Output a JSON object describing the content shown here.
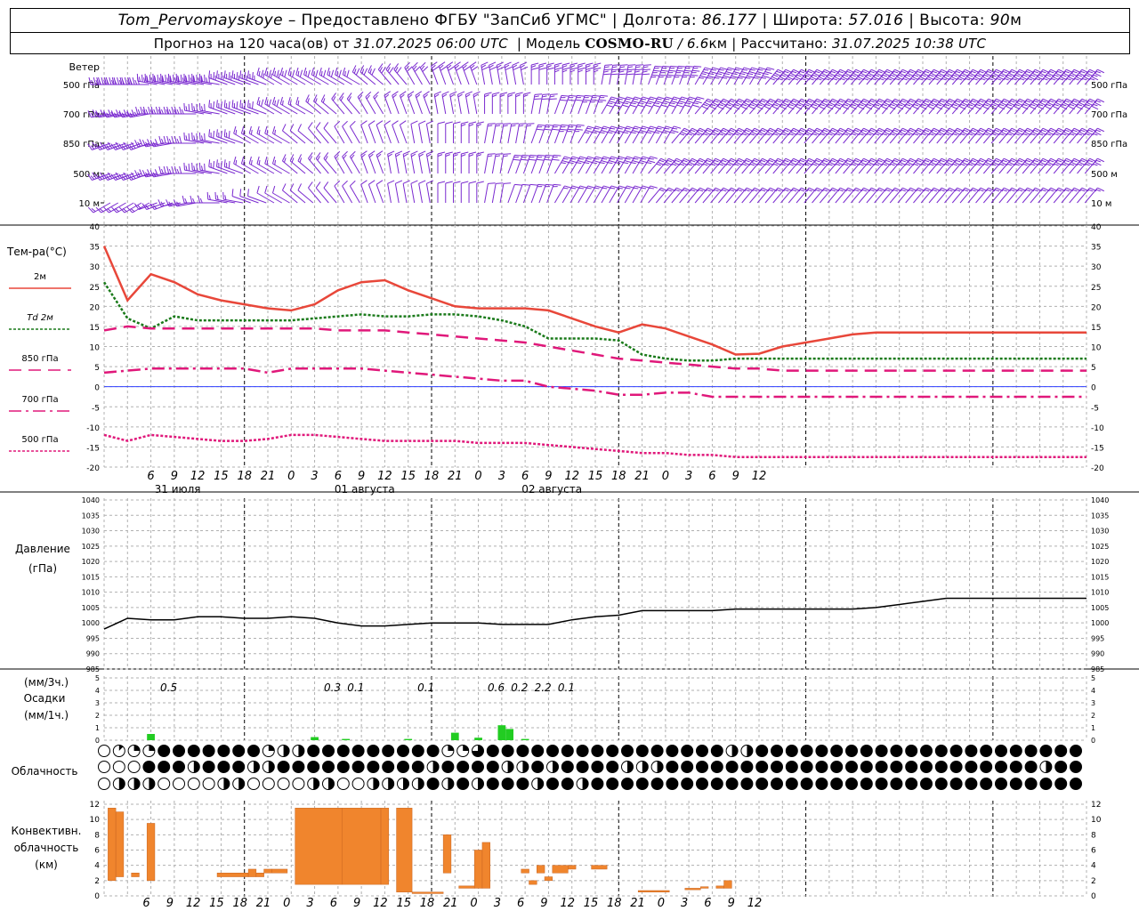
{
  "header": {
    "station": "Tom_Pervomayskoye",
    "dash": "–",
    "provider": "Предоставлено ФГБУ \"ЗапСиб УГМС\"",
    "lon_label": "Долгота:",
    "lon": "86.177",
    "lat_label": "Широта:",
    "lat": "57.016",
    "alt_label": "Высота:",
    "alt": "90",
    "alt_unit": "м",
    "sep": "|",
    "forecast_label": "Прогноз на 120 часа(ов)  от",
    "init": "31.07.2025 06:00 UTC",
    "model_label": "Модель",
    "model": "COSMO-RU",
    "model_res": "/ 6.6",
    "res_unit": "км",
    "calc_label": "Рассчитано:",
    "calc": "31.07.2025 10:38 UTC"
  },
  "labels": {
    "wind": "Ветер",
    "wind_levels": [
      "500 гПа",
      "700 гПа",
      "850 гПа",
      "500  м",
      "10   м"
    ],
    "temp": "Тем-ра(°С)",
    "pressure": [
      "Давление",
      "(гПа)"
    ],
    "precip": [
      "(мм/3ч.)",
      "Осадки",
      "(мм/1ч.)"
    ],
    "cloud": "Облачность",
    "conv": [
      "Конвективн.",
      "облачность",
      "(км)"
    ]
  },
  "colors": {
    "t2m": "#e8473a",
    "td": "#1a7a1a",
    "t850": "#e0187a",
    "t700": "#e0187a",
    "t500": "#e0187a",
    "wind": "#7a2ad0",
    "precip": "#22cc22",
    "conv": "#f0852d",
    "grid": "#b0b0b0"
  },
  "chart_data": [
    {
      "type": "line",
      "panel": "temperature",
      "ylabel": "Тем-ра(°С)",
      "ylim": [
        -20,
        40
      ],
      "yticks": [
        -20,
        -15,
        -10,
        -5,
        0,
        5,
        10,
        15,
        20,
        25,
        30,
        35,
        40
      ],
      "x_hours": [
        0,
        3,
        6,
        9,
        12,
        15,
        18,
        21,
        24,
        27,
        30,
        33,
        36,
        39,
        42,
        45,
        48,
        51,
        54,
        57,
        60,
        63,
        66,
        69,
        72,
        75,
        78,
        81,
        84,
        87,
        90,
        93,
        96,
        99,
        102,
        105,
        108,
        111,
        114,
        117,
        120,
        123,
        126
      ],
      "xtick_labels": [
        "6",
        "9",
        "12",
        "15",
        "18",
        "21",
        "0",
        "3",
        "6",
        "9",
        "12",
        "15",
        "18",
        "21",
        "0",
        "3",
        "6",
        "9",
        "12",
        "15",
        "18",
        "21",
        "0",
        "3",
        "6",
        "9",
        "12"
      ],
      "date_labels": [
        {
          "label": "31 июля",
          "hour": 6
        },
        {
          "label": "01 августа",
          "hour": 30
        },
        {
          "label": "02 августа",
          "hour": 54
        }
      ],
      "series": [
        {
          "name": "2м",
          "key": "t2m",
          "values": [
            35,
            21.5,
            28,
            26,
            23,
            21.5,
            20.5,
            19.5,
            19,
            20.5,
            24,
            26,
            26.5,
            24,
            22,
            20,
            19.5,
            19.5,
            19.5,
            19,
            17,
            15,
            13.5,
            15.5,
            14.5,
            12.5,
            10.5,
            8,
            8.2,
            10,
            11,
            12,
            13,
            13.5,
            13.5,
            13.5,
            13.5,
            13.5,
            13.5,
            13.5,
            13.5,
            13.5,
            13.5
          ]
        },
        {
          "name": "Td 2м",
          "key": "td",
          "values": [
            26,
            17,
            14.5,
            17.5,
            16.5,
            16.5,
            16.5,
            16.5,
            16.5,
            17,
            17.5,
            18,
            17.5,
            17.5,
            18,
            18,
            17.5,
            16.5,
            15,
            12,
            12,
            12,
            11.5,
            8,
            7,
            6.5,
            6.5,
            7,
            7,
            7,
            7,
            7,
            7,
            7,
            7,
            7,
            7,
            7,
            7,
            7,
            7,
            7,
            7
          ]
        },
        {
          "name": "850 гПа",
          "key": "t850",
          "values": [
            14,
            15,
            14.5,
            14.5,
            14.5,
            14.5,
            14.5,
            14.5,
            14.5,
            14.5,
            14,
            14,
            14,
            13.5,
            13,
            12.5,
            12,
            11.5,
            11,
            10,
            9,
            8,
            7,
            6.5,
            6,
            5.5,
            5,
            4.5,
            4.5,
            4,
            4,
            4,
            4,
            4,
            4,
            4,
            4,
            4,
            4,
            4,
            4,
            4,
            4
          ]
        },
        {
          "name": "700 гПа",
          "key": "t700",
          "values": [
            3.5,
            4,
            4.5,
            4.5,
            4.5,
            4.5,
            4.5,
            3.5,
            4.5,
            4.5,
            4.5,
            4.5,
            4,
            3.5,
            3,
            2.5,
            2,
            1.5,
            1.5,
            0,
            -0.5,
            -1,
            -2,
            -2,
            -1.5,
            -1.5,
            -2.5,
            -2.5,
            -2.5,
            -2.5,
            -2.5,
            -2.5,
            -2.5,
            -2.5,
            -2.5,
            -2.5,
            -2.5,
            -2.5,
            -2.5,
            -2.5,
            -2.5,
            -2.5,
            -2.5
          ]
        },
        {
          "name": "500 гПа",
          "key": "t500",
          "values": [
            -12,
            -13.5,
            -12,
            -12.5,
            -13,
            -13.5,
            -13.5,
            -13,
            -12,
            -12,
            -12.5,
            -13,
            -13.5,
            -13.5,
            -13.5,
            -13.5,
            -14,
            -14,
            -14,
            -14.5,
            -15,
            -15.5,
            -16,
            -16.5,
            -16.5,
            -17,
            -17,
            -17.5,
            -17.5,
            -17.5,
            -17.5,
            -17.5,
            -17.5,
            -17.5,
            -17.5,
            -17.5,
            -17.5,
            -17.5,
            -17.5,
            -17.5,
            -17.5,
            -17.5,
            -17.5
          ]
        }
      ]
    },
    {
      "type": "line",
      "panel": "pressure",
      "ylabel": "Давление (гПа)",
      "ylim": [
        985,
        1040
      ],
      "yticks": [
        985,
        990,
        995,
        1000,
        1005,
        1010,
        1015,
        1020,
        1025,
        1030,
        1035,
        1040
      ],
      "series": [
        {
          "name": "pressure",
          "values": [
            998,
            1001.5,
            1001,
            1001,
            1002,
            1002,
            1001.5,
            1001.5,
            1002,
            1001.5,
            1000,
            999,
            999,
            999.5,
            1000,
            1000,
            1000,
            999.5,
            999.5,
            999.5,
            1001,
            1002,
            1002.5,
            1004,
            1004,
            1004,
            1004,
            1004.5,
            1004.5,
            1004.5,
            1004.5,
            1004.5,
            1004.5,
            1005,
            1006,
            1007,
            1008,
            1008,
            1008,
            1008,
            1008,
            1008,
            1008
          ]
        }
      ]
    },
    {
      "type": "bar",
      "panel": "precipitation",
      "ylabel": "Осадки",
      "ylim": [
        0,
        5
      ],
      "yticks": [
        0,
        1,
        2,
        3,
        4,
        5
      ],
      "bars": [
        {
          "hour": 5.5,
          "value": 0.5
        },
        {
          "hour": 26.5,
          "value": 0.25
        },
        {
          "hour": 30.5,
          "value": 0.1
        },
        {
          "hour": 38.5,
          "value": 0.1
        },
        {
          "hour": 44.5,
          "value": 0.6
        },
        {
          "hour": 47.5,
          "value": 0.2
        },
        {
          "hour": 50.5,
          "value": 1.2
        },
        {
          "hour": 51.5,
          "value": 0.9
        },
        {
          "hour": 53.5,
          "value": 0.1
        }
      ],
      "sum_labels": [
        {
          "hour": 6,
          "value": "0.5"
        },
        {
          "hour": 27,
          "value": "0.3"
        },
        {
          "hour": 30,
          "value": "0.1"
        },
        {
          "hour": 39,
          "value": "0.1"
        },
        {
          "hour": 48,
          "value": "0.6"
        },
        {
          "hour": 51,
          "value": "0.2"
        },
        {
          "hour": 54,
          "value": "2.2"
        },
        {
          "hour": 57,
          "value": "0.1"
        }
      ]
    },
    {
      "type": "bar",
      "panel": "convective_cloud",
      "ylabel": "Конвективн. облачность (км)",
      "ylim": [
        0,
        12
      ],
      "yticks": [
        0,
        2,
        4,
        6,
        8,
        10,
        12
      ],
      "bars": [
        {
          "h0": 0.5,
          "h1": 1.5,
          "bot": 2,
          "top": 11.5
        },
        {
          "h0": 1.5,
          "h1": 2.5,
          "bot": 2.5,
          "top": 11
        },
        {
          "h0": 3.5,
          "h1": 4.5,
          "bot": 2.5,
          "top": 3
        },
        {
          "h0": 5.5,
          "h1": 6.5,
          "bot": 2,
          "top": 9.5
        },
        {
          "h0": 14.5,
          "h1": 18.5,
          "bot": 2.5,
          "top": 3
        },
        {
          "h0": 18.5,
          "h1": 19.5,
          "bot": 2.5,
          "top": 3.5
        },
        {
          "h0": 19.5,
          "h1": 20.5,
          "bot": 2.5,
          "top": 3
        },
        {
          "h0": 20.5,
          "h1": 21.5,
          "bot": 3,
          "top": 3.5
        },
        {
          "h0": 21.5,
          "h1": 23.5,
          "bot": 3,
          "top": 3.5
        },
        {
          "h0": 24.5,
          "h1": 30.5,
          "bot": 1.5,
          "top": 11.5
        },
        {
          "h0": 30.5,
          "h1": 35.5,
          "bot": 1.5,
          "top": 11.5
        },
        {
          "h0": 35.5,
          "h1": 36.5,
          "bot": 1.5,
          "top": 11.5
        },
        {
          "h0": 37.5,
          "h1": 39.5,
          "bot": 0.5,
          "top": 11.5
        },
        {
          "h0": 39.5,
          "h1": 43.5,
          "bot": 0.3,
          "top": 0.5
        },
        {
          "h0": 43.5,
          "h1": 44.5,
          "bot": 3,
          "top": 8
        },
        {
          "h0": 45.5,
          "h1": 47.5,
          "bot": 1,
          "top": 1.3
        },
        {
          "h0": 47.5,
          "h1": 48.5,
          "bot": 1,
          "top": 6
        },
        {
          "h0": 48.5,
          "h1": 49.5,
          "bot": 1,
          "top": 7
        },
        {
          "h0": 53.5,
          "h1": 54.5,
          "bot": 3,
          "top": 3.5
        },
        {
          "h0": 54.5,
          "h1": 55.5,
          "bot": 1.5,
          "top": 2
        },
        {
          "h0": 55.5,
          "h1": 56.5,
          "bot": 3,
          "top": 4
        },
        {
          "h0": 56.5,
          "h1": 57.5,
          "bot": 2,
          "top": 2.5
        },
        {
          "h0": 57.5,
          "h1": 59.5,
          "bot": 3,
          "top": 4
        },
        {
          "h0": 59.5,
          "h1": 60.5,
          "bot": 3.5,
          "top": 4
        },
        {
          "h0": 62.5,
          "h1": 64.5,
          "bot": 3.5,
          "top": 4
        },
        {
          "h0": 68.5,
          "h1": 72.5,
          "bot": 0.5,
          "top": 0.7
        },
        {
          "h0": 74.5,
          "h1": 76.5,
          "bot": 0.8,
          "top": 1
        },
        {
          "h0": 76.5,
          "h1": 77.5,
          "bot": 1,
          "top": 1.2
        },
        {
          "h0": 78.5,
          "h1": 79.5,
          "bot": 1,
          "top": 1.3
        },
        {
          "h0": 79.5,
          "h1": 80.5,
          "bot": 1,
          "top": 2
        }
      ]
    },
    {
      "type": "table",
      "panel": "cloud_cover",
      "ylabel": "Облачность",
      "rows": [
        "012288888882448888888882268888888888888888448888888888888888888888",
        "000888488844888888888848888448488884448888888888888888888888888488",
        "044400004400004400444484848884884888888888888888888888888888888888"
      ]
    },
    {
      "type": "table",
      "panel": "wind",
      "ylabel": "Ветер",
      "levels": [
        "500 гПа",
        "700 гПа",
        "850 гПа",
        "500  м",
        "10   м"
      ],
      "dir_deg": [
        [
          270,
          270,
          280,
          280,
          280,
          290,
          290,
          300,
          300,
          300,
          300,
          310,
          320,
          330,
          340,
          340,
          350,
          350,
          0,
          0,
          0,
          10,
          10,
          20,
          20,
          30,
          30,
          30,
          40,
          40,
          40,
          40,
          40,
          40,
          40,
          40,
          40,
          40,
          40,
          40,
          40,
          40,
          40
        ],
        [
          260,
          260,
          270,
          270,
          280,
          290,
          290,
          300,
          300,
          310,
          320,
          330,
          340,
          340,
          350,
          350,
          0,
          0,
          10,
          20,
          20,
          30,
          30,
          30,
          30,
          40,
          40,
          40,
          40,
          40,
          40,
          40,
          40,
          40,
          40,
          40,
          40,
          40,
          40,
          40,
          40,
          40,
          40
        ],
        [
          250,
          250,
          260,
          270,
          280,
          290,
          300,
          300,
          310,
          320,
          330,
          340,
          340,
          350,
          0,
          0,
          10,
          10,
          20,
          20,
          30,
          30,
          30,
          30,
          40,
          40,
          40,
          40,
          40,
          40,
          40,
          40,
          40,
          40,
          40,
          40,
          40,
          40,
          40,
          40,
          40,
          40,
          40
        ],
        [
          250,
          250,
          260,
          270,
          280,
          290,
          300,
          300,
          310,
          320,
          330,
          340,
          350,
          350,
          0,
          0,
          10,
          20,
          20,
          30,
          30,
          30,
          30,
          40,
          40,
          40,
          40,
          40,
          40,
          40,
          40,
          40,
          40,
          40,
          40,
          40,
          40,
          40,
          40,
          40,
          40,
          40,
          40
        ],
        [
          240,
          240,
          250,
          260,
          270,
          280,
          290,
          300,
          310,
          320,
          330,
          340,
          350,
          350,
          0,
          0,
          10,
          20,
          20,
          30,
          30,
          30,
          30,
          40,
          40,
          40,
          40,
          40,
          40,
          40,
          40,
          40,
          40,
          40,
          40,
          40,
          40,
          40,
          40,
          40,
          40,
          40,
          40
        ]
      ],
      "speed_kt": [
        [
          25,
          25,
          25,
          25,
          25,
          20,
          20,
          20,
          15,
          15,
          15,
          15,
          15,
          15,
          15,
          15,
          15,
          15,
          15,
          20,
          20,
          25,
          25,
          30,
          30,
          30,
          30,
          30,
          30,
          30,
          30,
          30,
          30,
          30,
          30,
          30,
          30,
          30,
          30,
          30,
          30,
          30,
          30
        ],
        [
          20,
          20,
          20,
          20,
          15,
          15,
          15,
          15,
          10,
          10,
          10,
          10,
          10,
          10,
          10,
          10,
          10,
          10,
          15,
          15,
          20,
          25,
          25,
          25,
          25,
          25,
          25,
          25,
          25,
          25,
          25,
          25,
          25,
          25,
          25,
          25,
          25,
          25,
          25,
          25,
          25,
          25,
          25
        ],
        [
          15,
          15,
          15,
          15,
          15,
          15,
          10,
          10,
          5,
          5,
          5,
          5,
          5,
          5,
          5,
          10,
          10,
          10,
          15,
          20,
          20,
          20,
          20,
          20,
          20,
          20,
          20,
          20,
          20,
          20,
          20,
          20,
          20,
          20,
          20,
          20,
          20,
          20,
          20,
          20,
          20,
          20,
          20
        ],
        [
          15,
          15,
          15,
          15,
          15,
          15,
          10,
          10,
          10,
          10,
          10,
          10,
          10,
          10,
          10,
          10,
          10,
          15,
          15,
          20,
          20,
          20,
          20,
          20,
          20,
          20,
          20,
          20,
          20,
          20,
          20,
          20,
          20,
          20,
          20,
          20,
          20,
          20,
          20,
          20,
          20,
          20,
          20
        ],
        [
          10,
          10,
          10,
          10,
          10,
          10,
          5,
          5,
          5,
          5,
          5,
          5,
          5,
          5,
          5,
          5,
          5,
          5,
          10,
          10,
          10,
          10,
          10,
          10,
          10,
          10,
          10,
          10,
          10,
          10,
          10,
          10,
          10,
          10,
          10,
          10,
          10,
          10,
          10,
          10,
          10,
          10,
          10
        ]
      ]
    }
  ]
}
